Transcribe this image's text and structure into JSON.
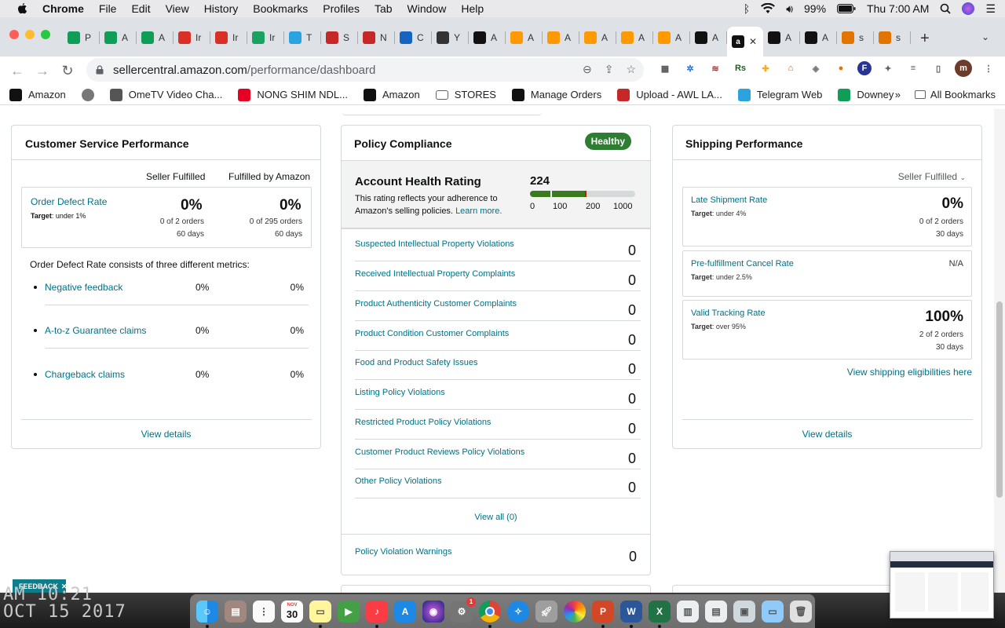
{
  "menubar": {
    "app": "Chrome",
    "items": [
      "File",
      "Edit",
      "View",
      "History",
      "Bookmarks",
      "Profiles",
      "Tab",
      "Window",
      "Help"
    ],
    "battery": "99%",
    "clock": "Thu 7:00 AM"
  },
  "tabs": [
    {
      "letter": "P",
      "icon": "sheets-icon",
      "color": "#0f9d58"
    },
    {
      "letter": "A",
      "icon": "sheets-icon",
      "color": "#0f9d58"
    },
    {
      "letter": "A",
      "icon": "sheets-icon",
      "color": "#0f9d58"
    },
    {
      "letter": "Ir",
      "icon": "gmail-icon",
      "color": "#d93025"
    },
    {
      "letter": "Ir",
      "icon": "gmail-icon",
      "color": "#d93025"
    },
    {
      "letter": "Ir",
      "icon": "green-circle-icon",
      "color": "#1aa260"
    },
    {
      "letter": "T",
      "icon": "telegram-icon",
      "color": "#2aa3df"
    },
    {
      "letter": "S",
      "icon": "s-icon",
      "color": "#c62828"
    },
    {
      "letter": "N",
      "icon": "s-icon",
      "color": "#c62828"
    },
    {
      "letter": "C",
      "icon": "s-icon",
      "color": "#1565c0"
    },
    {
      "letter": "Y",
      "icon": "shield-icon",
      "color": "#333333"
    },
    {
      "letter": "A",
      "icon": "amazon-icon",
      "color": "#111111"
    },
    {
      "letter": "A",
      "icon": "amazon-icon",
      "color": "#ff9900"
    },
    {
      "letter": "A",
      "icon": "amazon-icon",
      "color": "#ff9900"
    },
    {
      "letter": "A",
      "icon": "amazon-icon",
      "color": "#ff9900"
    },
    {
      "letter": "A",
      "icon": "amazon-icon",
      "color": "#ff9900"
    },
    {
      "letter": "A",
      "icon": "amazon-icon",
      "color": "#ff9900"
    },
    {
      "letter": "A",
      "icon": "amazon-icon",
      "color": "#111111"
    },
    {
      "letter": "A",
      "icon": "amazon-icon",
      "color": "#111111"
    },
    {
      "letter": "A",
      "icon": "amazon-icon",
      "color": "#111111"
    },
    {
      "letter": "s",
      "icon": "ring-icon",
      "color": "#e37400"
    },
    {
      "letter": "s",
      "icon": "ring-icon",
      "color": "#e37400"
    }
  ],
  "active_tab_close": "✕",
  "address": {
    "host": "sellercentral.amazon.com",
    "path": "/performance/dashboard"
  },
  "profile_initial": "m",
  "bookmarks": [
    {
      "label": "Amazon",
      "icon": "amazon-icon"
    },
    {
      "label": "",
      "icon": "globe-icon"
    },
    {
      "label": "OmeTV Video Cha...",
      "icon": "ometv-icon"
    },
    {
      "label": "NONG SHIM NDL...",
      "icon": "pinterest-icon"
    },
    {
      "label": "Amazon",
      "icon": "amazon-icon"
    },
    {
      "label": "STORES",
      "icon": "folder-icon"
    },
    {
      "label": "Manage Orders",
      "icon": "amazon-icon"
    },
    {
      "label": "Upload - AWL LA...",
      "icon": "awl-icon"
    },
    {
      "label": "Telegram Web",
      "icon": "telegram-icon"
    },
    {
      "label": "Downey",
      "icon": "sheets-icon"
    }
  ],
  "bookmarks_more": "»",
  "all_bookmarks": "All Bookmarks",
  "customer_service": {
    "title": "Customer Service Performance",
    "col1": "Seller Fulfilled",
    "col2": "Fulfilled by Amazon",
    "odr_label": "Order Defect Rate",
    "odr_target_label": "Target",
    "odr_target_value": ": under 1%",
    "sf_pct": "0%",
    "sf_orders": "0 of 2 orders",
    "sf_days": "60 days",
    "fba_pct": "0%",
    "fba_orders": "0 of 295 orders",
    "fba_days": "60 days",
    "consists": "Order Defect Rate consists of three different metrics:",
    "metrics": [
      {
        "label": "Negative feedback",
        "sf": "0%",
        "fba": "0%"
      },
      {
        "label": "A-to-z Guarantee claims",
        "sf": "0%",
        "fba": "0%"
      },
      {
        "label": "Chargeback claims",
        "sf": "0%",
        "fba": "0%"
      }
    ],
    "view_details": "View details"
  },
  "policy": {
    "title": "Policy Compliance",
    "status": "Healthy",
    "ahr_title": "Account Health Rating",
    "ahr_desc": "This rating reflects your adherence to Amazon's selling policies.",
    "learn_more": "Learn more.",
    "score": "224",
    "score_value": 224,
    "scale": [
      "0",
      "100",
      "200",
      "1000"
    ],
    "rows": [
      {
        "label": "Suspected Intellectual Property Violations",
        "value": "0"
      },
      {
        "label": "Received Intellectual Property Complaints",
        "value": "0"
      },
      {
        "label": "Product Authenticity Customer Complaints",
        "value": "0"
      },
      {
        "label": "Product Condition Customer Complaints",
        "value": "0"
      },
      {
        "label": "Food and Product Safety Issues",
        "value": "0"
      },
      {
        "label": "Listing Policy Violations",
        "value": "0"
      },
      {
        "label": "Restricted Product Policy Violations",
        "value": "0"
      },
      {
        "label": "Customer Product Reviews Policy Violations",
        "value": "0"
      },
      {
        "label": "Other Policy Violations",
        "value": "0"
      }
    ],
    "view_all": "View all (0)",
    "warnings_label": "Policy Violation Warnings",
    "warnings_value": "0"
  },
  "shipping": {
    "title": "Shipping Performance",
    "selector": "Seller Fulfilled",
    "late": {
      "label": "Late Shipment Rate",
      "target_label": "Target",
      "target_value": ": under 4%",
      "pct": "0%",
      "orders": "0 of 2 orders",
      "days": "30 days"
    },
    "cancel": {
      "label": "Pre-fulfillment Cancel Rate",
      "target_label": "Target",
      "target_value": ": under 2.5%",
      "value": "N/A"
    },
    "tracking": {
      "label": "Valid Tracking Rate",
      "target_label": "Target",
      "target_value": ": over 95%",
      "pct": "100%",
      "orders": "2 of 2 orders",
      "days": "30 days"
    },
    "eligibility_link": "View shipping eligibilities here",
    "view_details": "View details"
  },
  "feedback": "FEEDBACK",
  "feedback_close": "✕",
  "desktop_clock": [
    "AM 10:21",
    "OCT 15 2017"
  ],
  "dock_calendar": {
    "month": "NOV",
    "day": "30"
  },
  "dock_badge": "1"
}
